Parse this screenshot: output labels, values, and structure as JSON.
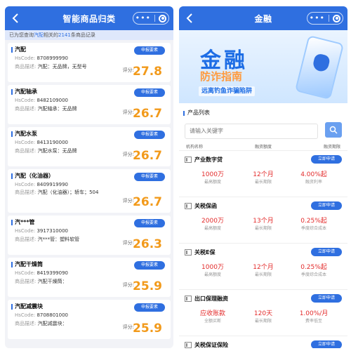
{
  "left": {
    "title": "智能商品归类",
    "record": {
      "prefix": "已为您查询",
      "keyword": "汽配",
      "mid": "相关的",
      "count": "2141",
      "suffix": "条商品记录"
    },
    "labels": {
      "hscode": "HsCode:",
      "desc": "商品描述:",
      "score": "评分:",
      "button": "申报要素"
    },
    "items": [
      {
        "name": "汽配",
        "hscode": "8708999990",
        "desc": "汽配：无品牌，无型号",
        "score": "27.8"
      },
      {
        "name": "汽配轴承",
        "hscode": "8482109000",
        "desc": "汽配轴承：无品牌",
        "score": "26.7"
      },
      {
        "name": "汽配水泵",
        "hscode": "8413190000",
        "desc": "汽配水泵：无品牌",
        "score": "26.7"
      },
      {
        "name": "汽配（化油器）",
        "hscode": "8409919990",
        "desc": "汽配（化油器）；轿车；504",
        "score": "26.7"
      },
      {
        "name": "汽***管",
        "hscode": "3917310000",
        "desc": "汽***管：塑料软管",
        "score": "26.3"
      },
      {
        "name": "汽配干燥筒",
        "hscode": "8419399090",
        "desc": "汽配干燥筒：",
        "score": "25.9"
      },
      {
        "name": "汽配减震块",
        "hscode": "8708801000",
        "desc": "汽配减震块：",
        "score": "25.9"
      }
    ]
  },
  "right": {
    "title": "金融",
    "banner": {
      "big": "金融",
      "sub": "防诈指南",
      "tag": "远离钓鱼诈骗陷阱"
    },
    "list_title": "产品列表",
    "search": {
      "placeholder": "请输入关键字"
    },
    "columns": [
      "机构名称",
      "融资额度",
      "融资期限"
    ],
    "apply_label": "立即申请",
    "products": [
      {
        "name": "产业数字贷",
        "stats": [
          {
            "v": "1000万",
            "l": "最高额度"
          },
          {
            "v": "12个月",
            "l": "最长期限"
          },
          {
            "v": "4.00%起",
            "l": "融资利率"
          }
        ]
      },
      {
        "name": "关税保函",
        "stats": [
          {
            "v": "2000万",
            "l": "最高额度"
          },
          {
            "v": "13个月",
            "l": "最长期限"
          },
          {
            "v": "0.25%起",
            "l": "季度综合成本"
          }
        ]
      },
      {
        "name": "关税E保",
        "stats": [
          {
            "v": "1000万",
            "l": "最高额度"
          },
          {
            "v": "12个月",
            "l": "最长期限"
          },
          {
            "v": "0.25%起",
            "l": "季度综合成本"
          }
        ]
      },
      {
        "name": "出口保理融资",
        "stats": [
          {
            "v": "应收账款",
            "l": "全额买断"
          },
          {
            "v": "120天",
            "l": "最长期限"
          },
          {
            "v": "1.00%/月",
            "l": "费率低至"
          }
        ]
      },
      {
        "name": "关税保证保险"
      }
    ]
  },
  "colors": {
    "primary": "#2f6fe0",
    "score": "#f29a1b",
    "stat": "#e32b2b"
  }
}
